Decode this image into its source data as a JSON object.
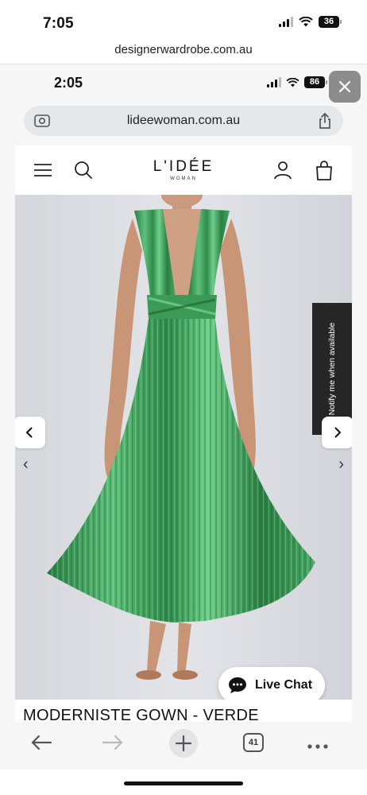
{
  "outer": {
    "time": "7:05",
    "battery": "36",
    "url": "designerwardrobe.com.au"
  },
  "inner": {
    "time": "2:05",
    "battery": "86",
    "address": "lideewoman.com.au"
  },
  "site": {
    "logo": "L'IDÉE",
    "logo_sub": "WOMAN",
    "notify_label": "Notify me when available",
    "live_chat_label": "Live Chat",
    "product_title": "MODERNISTE GOWN - VERDE"
  },
  "toolbar": {
    "tabs_count": "41"
  },
  "colors": {
    "gown": "#2f8b4a",
    "gown_highlight": "#6fcf8a",
    "backdrop": "#dcdde2",
    "notify_bg": "#262626"
  },
  "icons": [
    "menu-icon",
    "search-icon",
    "account-icon",
    "bag-icon",
    "close-icon",
    "share-icon",
    "back-icon",
    "forward-icon",
    "plus-icon",
    "more-icon",
    "chat-bubble-icon"
  ]
}
